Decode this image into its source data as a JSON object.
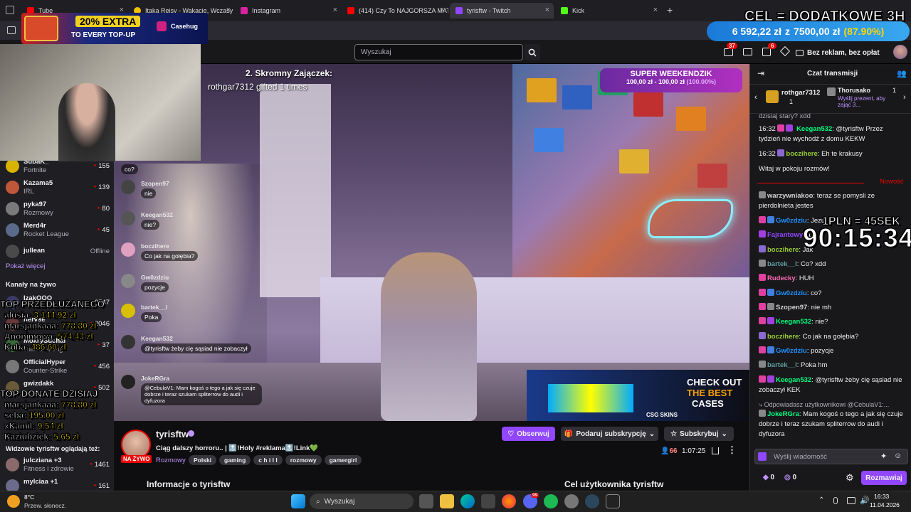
{
  "browser": {
    "tabs": [
      {
        "label": "Tube",
        "icon": "youtube-icon",
        "color": "#ff0000"
      },
      {
        "label": "Itaka Rejsy - Wakacje, Wczasy z",
        "icon": "itaka-icon",
        "color": "#f5c000"
      },
      {
        "label": "Instagram",
        "icon": "instagram-icon",
        "color": "#d6249f"
      },
      {
        "label": "(414) Czy To NAJGORSZA MAT",
        "icon": "youtube-icon",
        "color": "#ff0000"
      },
      {
        "label": "tyrisftw - Twitch",
        "icon": "twitch-icon",
        "color": "#9146ff"
      },
      {
        "label": "Kick",
        "icon": "kick-icon",
        "color": "#53fc18"
      }
    ]
  },
  "overlay": {
    "goal_title": "CEL = DODATKOWE 3H",
    "goal_amount": "6 592,22 zł",
    "goal_z": "z",
    "goal_target": "7500,00 zł",
    "goal_percent": "(87.90%)",
    "promo_extra": "20% EXTRA",
    "promo_sub": "TO EVERY TOP-UP",
    "promo_brand": "Casehug",
    "top_text_1": "2. Skromny Zajączek:",
    "top_text_2": "rothgar7312 gifted 1 times",
    "weekend_title": "SUPER WEEKENDZIK",
    "weekend_amount": "100,00 zł - 100,00 zł",
    "weekend_pct": "(100.00%)",
    "ad_check": "CHECK OUT",
    "ad_best": "THE BEST",
    "ad_cases": "CASES",
    "ad_brand": "CSG SKINS",
    "rate": "1PLN = 45SEK",
    "timer": "90:15:34",
    "top_przedluzanego": "TOP PRZEDŁUŻANEGO",
    "prz": [
      {
        "name": "alusia:",
        "amount": "3 144,92 zł"
      },
      {
        "name": "marsjankaaa:",
        "amount": "778,80 zł"
      },
      {
        "name": "Anonimowa:",
        "amount": "574,43 zł"
      },
      {
        "name": "Kuba:",
        "amount": "486,60 zł"
      }
    ],
    "top_donate": "TOP DONATE DZISIAJ",
    "don": [
      {
        "name": "marsjankaaa:",
        "amount": "778,80 zł"
      },
      {
        "name": "seba:",
        "amount": "195,00 zł"
      },
      {
        "name": "xKamil:",
        "amount": "9,54 zł"
      },
      {
        "name": "Kaziubziek:",
        "amount": "5,65 zł"
      }
    ]
  },
  "video_chat": [
    {
      "name": "",
      "msg": "co?"
    },
    {
      "name": "Szopen97",
      "msg": "nie"
    },
    {
      "name": "Keegan532",
      "msg": "nie?"
    },
    {
      "name": "boczihere",
      "msg": "Co jak na gołębia?"
    },
    {
      "name": "Gw0zdziu",
      "msg": "pozycje"
    },
    {
      "name": "bartek__l",
      "msg": "Poka"
    },
    {
      "name": "Keegan532",
      "msg": "@tyrisftw żeby cię sąsiad nie zobaczył"
    },
    {
      "name": "JokeRGra",
      "msg": "@CebulaV1: Mam kogoś o tego a jak się czuje dobrze i teraz szukam spliterrow do audi i dyfuzora"
    }
  ],
  "header": {
    "search_placeholder": "Wyszukaj",
    "notif_count": "37",
    "inbox_count": "6",
    "no_ads": "Bez reklam, bez opłat"
  },
  "sidebar": {
    "channels": [
      {
        "name": "SubaK_",
        "game": "Fortnite",
        "viewers": "155",
        "color": "#2a2a2a"
      },
      {
        "name": "Kazama5",
        "game": "IRL",
        "viewers": "139",
        "color": "#c0563a"
      },
      {
        "name": "pyka97",
        "game": "Rozmowy",
        "viewers": "80",
        "color": "#7a7a7a"
      },
      {
        "name": "Merd4r",
        "game": "Rocket League",
        "viewers": "45",
        "color": "#5a6a8a"
      },
      {
        "name": "jullean",
        "game": "",
        "viewers": "Offline",
        "color": "#4a4a4a"
      }
    ],
    "show_more": "Pokaż więcej",
    "live_heading": "Kanały na żywo",
    "live": [
      {
        "name": "IzakOOO",
        "game": "",
        "viewers": "2547",
        "color": "#3a3a6a"
      },
      {
        "name": "nervse",
        "game": "",
        "viewers": "2046",
        "color": "#6a3a3a"
      },
      {
        "name": "MokrySuchar",
        "game": "Just Chatting",
        "viewers": "37",
        "color": "#3a6a3a"
      },
      {
        "name": "OfficialHyper",
        "game": "Counter-Strike",
        "viewers": "456",
        "color": "#555"
      },
      {
        "name": "gwizdakk",
        "game": "",
        "viewers": "502",
        "color": "#6a5a3a"
      }
    ],
    "also_watch": "Widzowie tyrisftw oglądają też:",
    "also": [
      {
        "name": "julcziana +3",
        "game": "Fitness i zdrowie",
        "viewers": "1461",
        "color": "#8a6a6a"
      },
      {
        "name": "mylciaa +1",
        "game": "",
        "viewers": "161",
        "color": "#6a6a8a"
      }
    ]
  },
  "stream": {
    "channel": "tyrisftw",
    "title": "Ciąg dalszy horroru.. | 🔝!Holy #reklama🔝!Link💚",
    "live_badge": "NA ŻYWO",
    "category": "Rozmowy",
    "tags": [
      "Polski",
      "gaming",
      "c h i l l",
      "rozmowy",
      "gamergirl"
    ],
    "follow": "Obserwuj",
    "gift": "Podaruj subskrypcję",
    "subscribe": "Subskrybuj",
    "viewers": "66",
    "uptime": "1:07:25",
    "about": "Informacje o tyrisftw",
    "goal_section": "Cel użytkownika tyrisftw"
  },
  "chat": {
    "title": "Czat transmisji",
    "pinned_1_name": "rothgar7312",
    "pinned_1_count": "1",
    "pinned_2_name": "Thorusako",
    "pinned_2_count": "1",
    "pinned_2_cta": "Wyślij prezent, aby zająć 3...",
    "welcome": "Witaj w pokoju rozmów!",
    "new_label": "Nowość",
    "pre": [
      {
        "text": "dzisiaj stary? xdd"
      },
      {
        "time": "16:32",
        "name": "Keegan532",
        "color": "#00ff7f",
        "msg": "@tyrisftw Przez tydzień nie wychodź z domu KEKW"
      },
      {
        "time": "16:32",
        "name": "boczihere",
        "color": "#9acd32",
        "msg": "Eh te krakusy"
      }
    ],
    "messages": [
      {
        "name": "warzywniakoo",
        "color": "#d2d2d2",
        "msg": "teraz se pomysli ze pierdolnieta jestes"
      },
      {
        "name": "Gw0zdziu",
        "color": "#1e90ff",
        "msg": "Jezu"
      },
      {
        "name": "Fajrantowy",
        "color": "#9146ff",
        "msg": "a"
      },
      {
        "name": "boczihere",
        "color": "#9acd32",
        "msg": "Jak"
      },
      {
        "name": "bartek__l",
        "color": "#5f9ea0",
        "msg": "Co? xdd"
      },
      {
        "name": "Rudecky",
        "color": "#ff69b4",
        "msg": "HUH"
      },
      {
        "name": "Gw0zdziu",
        "color": "#1e90ff",
        "msg": "co?"
      },
      {
        "name": "Szopen97",
        "color": "#d2d2d2",
        "msg": "nie mh"
      },
      {
        "name": "Keegan532",
        "color": "#00ff7f",
        "msg": "nie?"
      },
      {
        "name": "boczihere",
        "color": "#9acd32",
        "msg": "Co jak na gołębia?"
      },
      {
        "name": "Gw0zdziu",
        "color": "#1e90ff",
        "msg": "pozycje"
      },
      {
        "name": "bartek__l",
        "color": "#5f9ea0",
        "msg": "Poka hm"
      },
      {
        "name": "Keegan532",
        "color": "#00ff7f",
        "msg": "@tyrisftw żeby cię sąsiad nie zobaczył KEK"
      }
    ],
    "reply_to": "Odpowiadasz użytkownikowi @CebulaV1:...",
    "last_name": "JokeRGra",
    "last_color": "#00ff7f",
    "last_msg": "Mam kogoś o tego a jak się czuje dobrze i teraz szukam spliterrow do audi i dyfuzora",
    "input_placeholder": "Wyślij wiadomość",
    "bits": "0",
    "points": "0",
    "send": "Rozmawiaj"
  },
  "taskbar": {
    "temp": "8°C",
    "weather": "Przew. słonecz.",
    "search": "Wyszukaj",
    "time": "16:33",
    "date": "11.04.2026",
    "discord_badge": "99"
  }
}
